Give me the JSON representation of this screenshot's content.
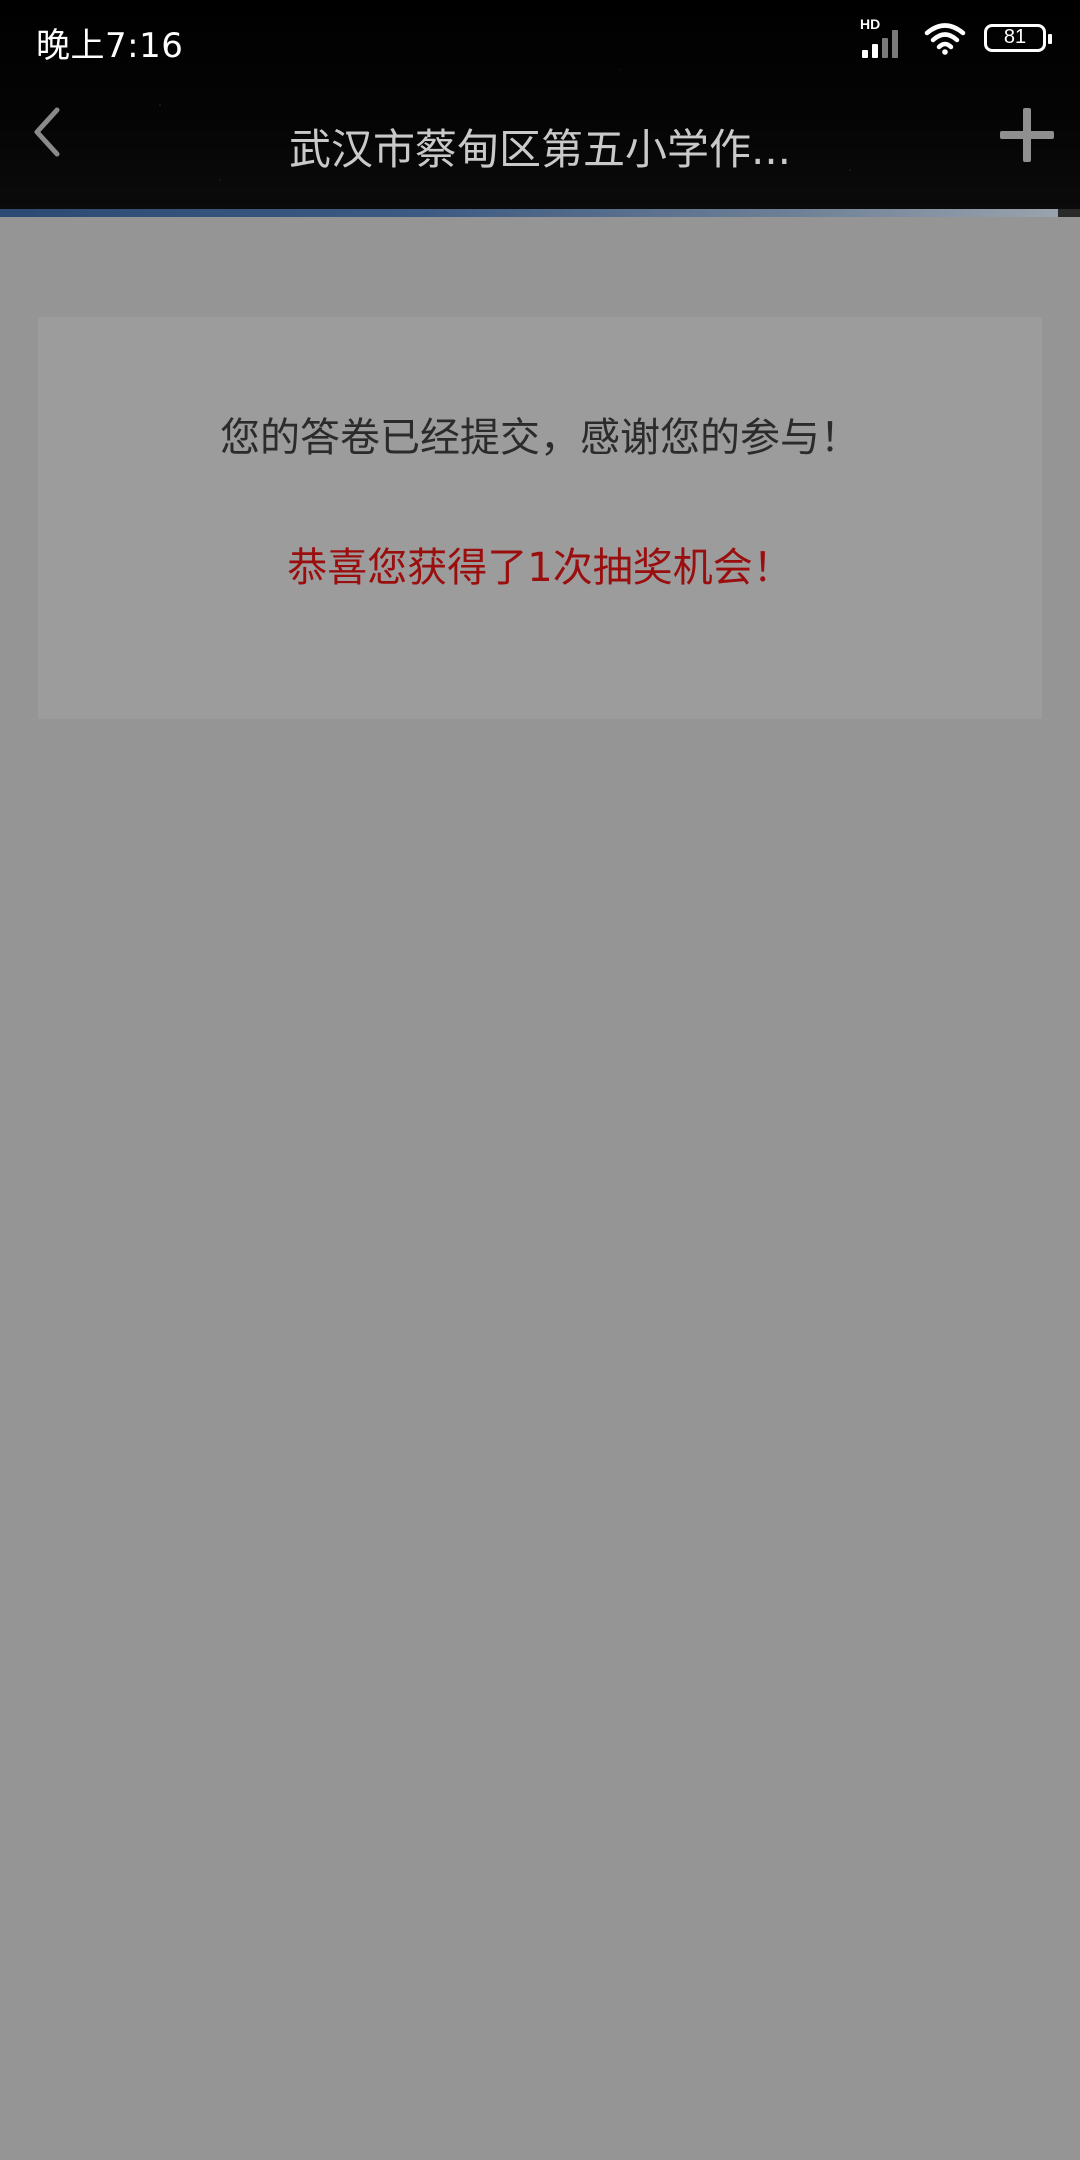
{
  "status_bar": {
    "time": "晚上7:16",
    "network_label": "HD",
    "signal_bars_on": 2,
    "signal_bars_total": 4,
    "battery_text": "81",
    "battery_level": 0.81
  },
  "nav": {
    "title": "武汉市蔡甸区第五小学作...",
    "back_icon": "chevron-left-icon",
    "add_icon": "plus-icon"
  },
  "progress": {
    "value": 0.98,
    "colors": [
      "#2c4a72",
      "#9aa3ad"
    ]
  },
  "result": {
    "submitted_message": "您的答卷已经提交，感谢您的参与！",
    "reward_message": "恭喜您获得了1次抽奖机会！",
    "reward_color": "#9a0e0e"
  }
}
